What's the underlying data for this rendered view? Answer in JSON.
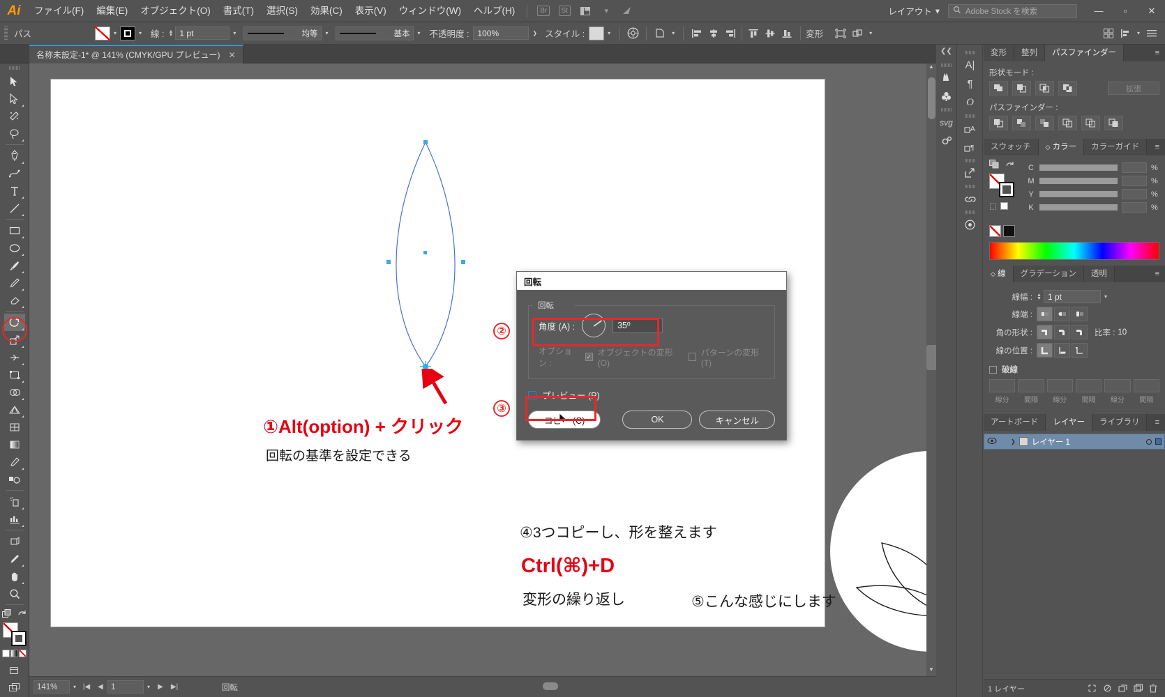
{
  "app": {
    "name": "Adobe Illustrator",
    "logo": "Ai"
  },
  "menubar": {
    "items": [
      {
        "label": "ファイル(F)"
      },
      {
        "label": "編集(E)"
      },
      {
        "label": "オブジェクト(O)"
      },
      {
        "label": "書式(T)"
      },
      {
        "label": "選択(S)"
      },
      {
        "label": "効果(C)"
      },
      {
        "label": "表示(V)"
      },
      {
        "label": "ウィンドウ(W)"
      },
      {
        "label": "ヘルプ(H)"
      }
    ],
    "bridge_badge": "Br",
    "stock_badge": "St",
    "layout_label": "レイアウト",
    "search_placeholder": "Adobe Stock を検索",
    "window_minimize": "—",
    "window_maximize": "▫",
    "window_close": "✕"
  },
  "controlbar": {
    "selection_label": "パス",
    "stroke_label": "線 :",
    "stroke_weight": "1 pt",
    "profile_uniform": "均等",
    "brush_basic": "基本",
    "opacity_label": "不透明度 :",
    "opacity_value": "100%",
    "style_label": "スタイル :",
    "transform_label": "変形"
  },
  "tabbar": {
    "document_title": "名称未設定-1* @ 141% (CMYK/GPU プレビュー)",
    "close_glyph": "✕"
  },
  "toolbar": {
    "selected_tool": "rotate-tool",
    "tools": [
      "selection-tool",
      "direct-selection-tool",
      "magic-wand-tool",
      "lasso-tool",
      "pen-tool",
      "curvature-tool",
      "type-tool",
      "line-segment-tool",
      "rectangle-tool",
      "ellipse-tool",
      "paintbrush-tool",
      "pencil-tool",
      "rotate-tool",
      "scale-tool",
      "width-tool",
      "free-transform-tool",
      "shape-builder-tool",
      "perspective-grid-tool",
      "mesh-tool",
      "gradient-tool",
      "eyedropper-tool",
      "blend-tool",
      "symbol-sprayer-tool",
      "column-graph-tool",
      "artboard-tool",
      "slice-tool",
      "hand-tool",
      "zoom-tool"
    ]
  },
  "statusbar": {
    "zoom_level": "141%",
    "page_number": "1",
    "tool_name": "回転"
  },
  "dialog": {
    "title": "回転",
    "group_label": "回転",
    "angle_label": "角度 (A) :",
    "angle_value": "35º",
    "angle_degrees": 35,
    "options_label": "オプション :",
    "transform_objects": "オブジェクトの変形 (O)",
    "transform_patterns": "パターンの変形 (T)",
    "preview_label": "プレビュー (P)",
    "copy_button": "コピー (C)",
    "ok_button": "OK",
    "cancel_button": "キャンセル"
  },
  "annotations": {
    "step1": "①Alt(option) + クリック",
    "step1_sub": "回転の基準を設定できる",
    "step2_marker": "②",
    "step3_marker": "③",
    "step4": "④3つコピーし、形を整えます",
    "step4_key": "Ctrl(⌘)+D",
    "step4_sub": "変形の繰り返し",
    "step5": "⑤こんな感じにします",
    "accent_color": "#e60012",
    "highlight_color": "#e8282b"
  },
  "panels": {
    "top_tabs": [
      {
        "label": "変形",
        "active": false
      },
      {
        "label": "整列",
        "active": false
      },
      {
        "label": "パスファインダー",
        "active": true
      }
    ],
    "pathfinder": {
      "shape_mode_label": "形状モード :",
      "pathfinder_label": "パスファインダー :",
      "expand_button": "拡張"
    },
    "color_tabs": [
      {
        "label": "スウォッチ",
        "active": false
      },
      {
        "label": "カラー",
        "active": true
      },
      {
        "label": "カラーガイド",
        "active": false
      }
    ],
    "color": {
      "channels": [
        {
          "name": "C",
          "value": "",
          "unit": "%"
        },
        {
          "name": "M",
          "value": "",
          "unit": "%"
        },
        {
          "name": "Y",
          "value": "",
          "unit": "%"
        },
        {
          "name": "K",
          "value": "",
          "unit": "%"
        }
      ]
    },
    "stroke_tabs": [
      {
        "label": "線",
        "active": true
      },
      {
        "label": "グラデーション",
        "active": false
      },
      {
        "label": "透明",
        "active": false
      }
    ],
    "stroke": {
      "weight_label": "線幅 :",
      "weight_value": "1 pt",
      "cap_label": "線端 :",
      "corner_label": "角の形状 :",
      "ratio_label": "比率 :",
      "ratio_value": "10",
      "align_label": "線の位置 :",
      "dash_label": "破線",
      "dash_fields": [
        "線分",
        "間隔",
        "線分",
        "間隔",
        "線分",
        "間隔"
      ]
    },
    "bottom_tabs": [
      {
        "label": "アートボード",
        "active": false
      },
      {
        "label": "レイヤー",
        "active": true
      },
      {
        "label": "ライブラリ",
        "active": false
      }
    ],
    "layers": {
      "rows": [
        {
          "name": "レイヤー 1"
        }
      ],
      "footer_count": "1 レイヤー"
    }
  }
}
